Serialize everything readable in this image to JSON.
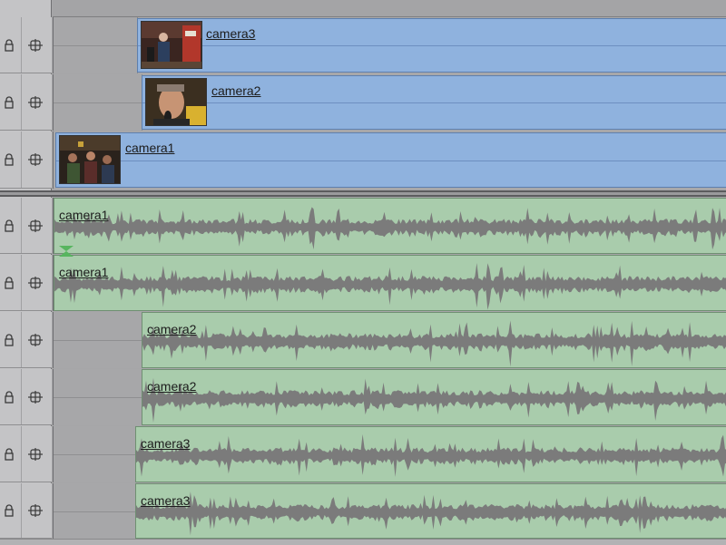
{
  "video_tracks": [
    {
      "label": "camera3",
      "thumb": "concert-stage-thumbnail",
      "icons": {
        "lock": "lock-icon",
        "link": "link-icon"
      }
    },
    {
      "label": "camera2",
      "thumb": "singer-closeup-thumbnail",
      "icons": {
        "lock": "lock-icon",
        "link": "link-icon"
      }
    },
    {
      "label": "camera1",
      "thumb": "crowd-band-thumbnail",
      "icons": {
        "lock": "lock-icon",
        "link": "link-icon"
      }
    }
  ],
  "audio_tracks": [
    {
      "label": "camera1"
    },
    {
      "label": "camera1"
    },
    {
      "label": "camera2"
    },
    {
      "label": "camera2"
    },
    {
      "label": "camera3"
    },
    {
      "label": "camera3"
    }
  ],
  "colors": {
    "video_clip": "#8fb2de",
    "audio_clip": "#a9ccac",
    "waveform": "#7b7b7b"
  }
}
